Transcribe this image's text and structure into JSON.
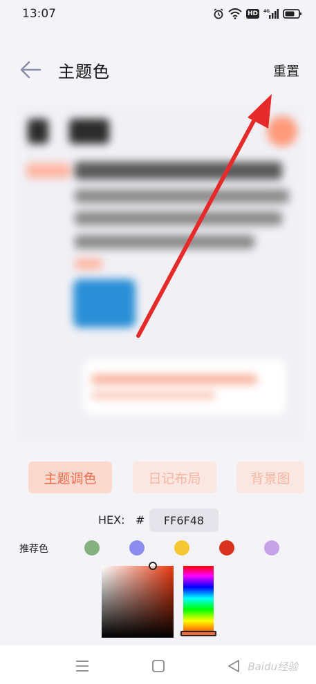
{
  "status_bar": {
    "time": "13:07",
    "hd": "HD",
    "network": "4G"
  },
  "header": {
    "title": "主题色",
    "reset_label": "重置"
  },
  "tabs": [
    {
      "label": "主题调色",
      "active": true
    },
    {
      "label": "日记布局",
      "active": false
    },
    {
      "label": "背景图",
      "active": false
    }
  ],
  "hex": {
    "label": "HEX:",
    "hash": "#",
    "value": "FF6F48"
  },
  "recommended": {
    "label": "推荐色",
    "colors": [
      "#85b07f",
      "#8c8cf0",
      "#f7c733",
      "#d9321f",
      "#c6a2e8"
    ]
  },
  "colors": {
    "accent": "#f06a4a",
    "annotation_arrow": "#e62a2a"
  },
  "watermark": "Baidu经验"
}
